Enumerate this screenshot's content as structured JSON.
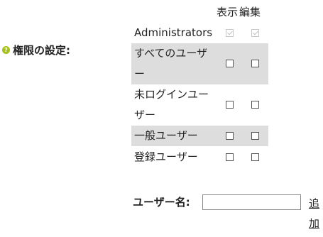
{
  "section": {
    "label": "権限の設定:",
    "help_icon": "?"
  },
  "columns": {
    "view": "表示",
    "edit": "編集"
  },
  "roles": [
    {
      "name": "Administrators",
      "view": true,
      "edit": true,
      "disabled": true
    },
    {
      "name": "すべてのユーザー",
      "view": false,
      "edit": false
    },
    {
      "name": "未ログインユーザー",
      "view": false,
      "edit": false
    },
    {
      "name": "一般ユーザー",
      "view": false,
      "edit": false
    },
    {
      "name": "登録ユーザー",
      "view": false,
      "edit": false
    }
  ],
  "username": {
    "label": "ユーザー名:",
    "value": "",
    "add_label": "追加"
  }
}
